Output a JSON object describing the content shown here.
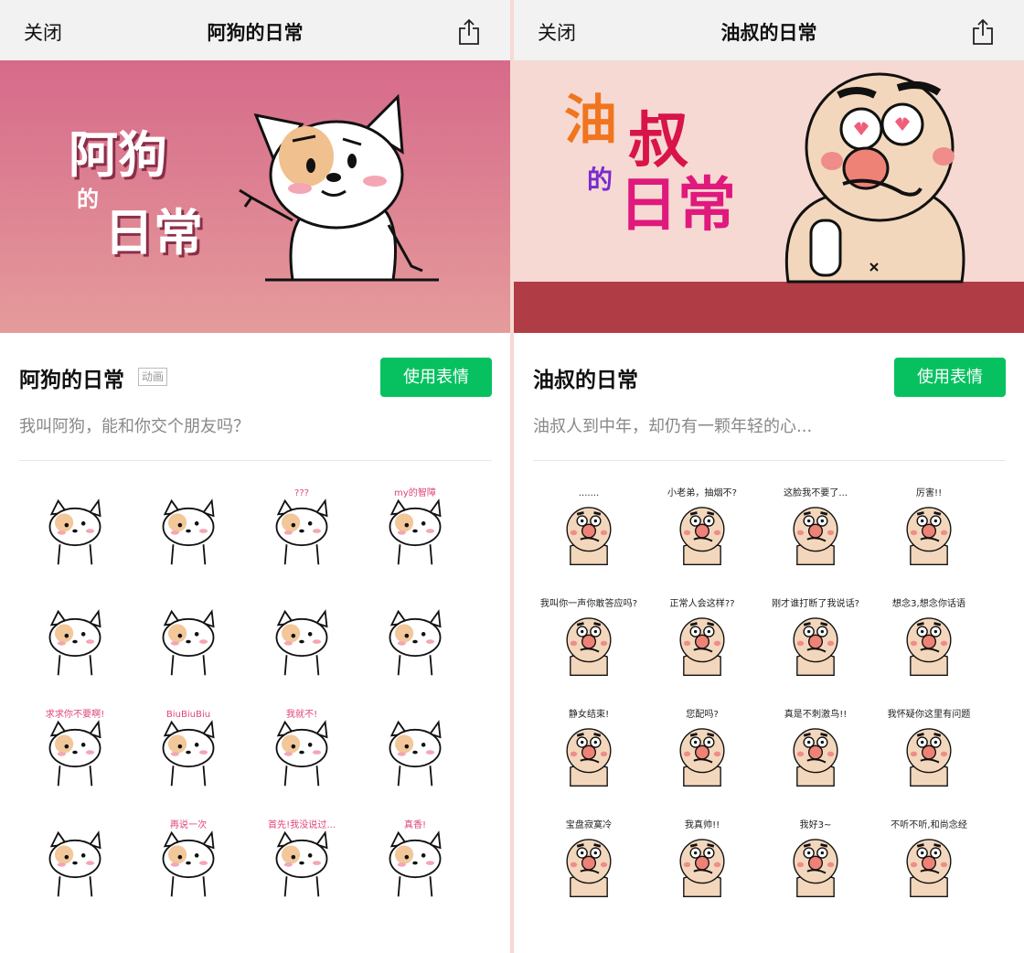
{
  "left": {
    "nav": {
      "close": "关闭",
      "title": "阿狗的日常",
      "share_icon": "share-icon"
    },
    "banner": {
      "title_line1": "阿狗",
      "title_de": "的",
      "title_line2": "日常",
      "bg_top": "#d66a8a",
      "bg_bottom": "#e59b9b"
    },
    "pack_name": "阿狗的日常",
    "badge": "动画",
    "use_button": "使用表情",
    "description": "我叫阿狗，能和你交个朋友吗？",
    "stickers": [
      {
        "caption": ""
      },
      {
        "caption": ""
      },
      {
        "caption": "???"
      },
      {
        "caption": "my的智障"
      },
      {
        "caption": ""
      },
      {
        "caption": ""
      },
      {
        "caption": ""
      },
      {
        "caption": ""
      },
      {
        "caption": "求求你不要啊!"
      },
      {
        "caption": "BiuBiuBiu"
      },
      {
        "caption": "我就不!"
      },
      {
        "caption": ""
      },
      {
        "caption": ""
      },
      {
        "caption": "再说一次"
      },
      {
        "caption": "首先!我没说过..."
      },
      {
        "caption": "真香!"
      }
    ]
  },
  "right": {
    "nav": {
      "close": "关闭",
      "title": "油叔的日常",
      "share_icon": "share-icon"
    },
    "banner": {
      "title_char1": "油",
      "title_char2": "叔",
      "title_de": "的",
      "title_line2": "日常",
      "bg": "#f6d9d2",
      "floor": "#b03c45"
    },
    "pack_name": "油叔的日常",
    "use_button": "使用表情",
    "description": "油叔人到中年，却仍有一颗年轻的心...",
    "stickers": [
      {
        "caption": "......."
      },
      {
        "caption": "小老弟，抽烟不?"
      },
      {
        "caption": "这脸我不要了..."
      },
      {
        "caption": "厉害!!"
      },
      {
        "caption": "我叫你一声你敢答应吗?"
      },
      {
        "caption": "正常人会这样??"
      },
      {
        "caption": "刚才谁打断了我说话?"
      },
      {
        "caption": "想念3,想念你话语"
      },
      {
        "caption": "静女结束!"
      },
      {
        "caption": "您配吗?"
      },
      {
        "caption": "真是不刺激鸟!!"
      },
      {
        "caption": "我怀疑你这里有问题"
      },
      {
        "caption": "宝盘寂寞冷"
      },
      {
        "caption": "我真帅!!"
      },
      {
        "caption": "我好3~"
      },
      {
        "caption": "不听不听,和尚念经"
      }
    ]
  },
  "accent": "#07c160"
}
